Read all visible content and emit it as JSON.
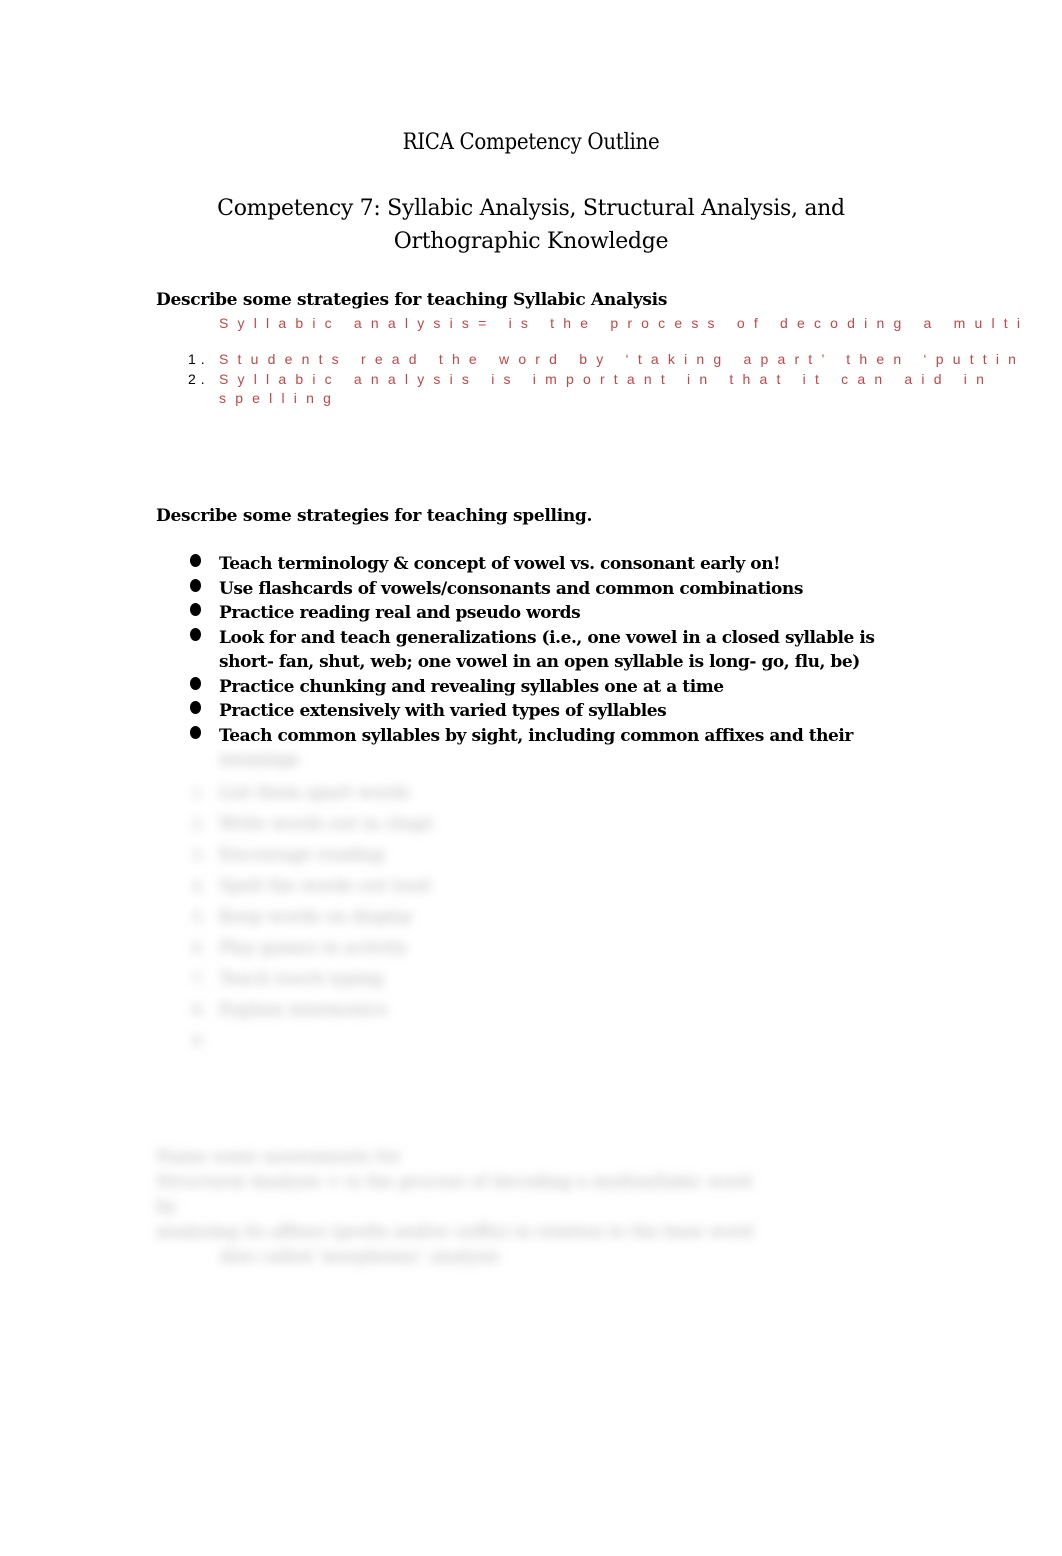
{
  "document": {
    "title": "RICA Competency Outline",
    "subtitle_line1": "Competency 7: Syllabic Analysis, Structural Analysis, and",
    "subtitle_line2": "Orthographic Knowledge"
  },
  "section_syllabic": {
    "heading": "Describe some strategies for teaching Syllabic Analysis",
    "definition": "Syllabic analysis= is the process of decoding a multi",
    "items": [
      {
        "number": "1.",
        "text": "Students read the word by ‘taking apart’ then ‘puttin"
      },
      {
        "number": "2.",
        "text": "Syllabic analysis is important in that it can aid in",
        "continuation": "spelling"
      }
    ],
    "text_color": "#c0474a"
  },
  "section_spelling": {
    "heading": "Describe some strategies for teaching spelling.",
    "bullets": [
      {
        "line1": "Teach terminology & concept of vowel vs. consonant early on!"
      },
      {
        "line1": "Use flashcards of vowels/consonants and common combinations"
      },
      {
        "line1": "Practice reading real and pseudo words"
      },
      {
        "line1": "Look for and teach generalizations (i.e., one vowel in a closed syllable is",
        "line2": "short- fan, shut, web; one vowel in an open syllable is long- go, flu, be)"
      },
      {
        "line1": "Practice chunking and revealing syllables one at a time"
      },
      {
        "line1": "Practice extensively with varied types of syllables"
      },
      {
        "line1": "Teach common syllables by sight, including common affixes and their",
        "line2": "meanings"
      }
    ]
  },
  "blurred_content": {
    "list_items": [
      "List them apart words",
      "Write words out in chapt",
      "Encourage reading",
      "Spell the words out loud",
      "Keep words on display",
      "Play games in activity",
      "Teach touch typing",
      "Explain mnemonics",
      ""
    ],
    "block_lines": [
      "Name some assessments for",
      "Structural Analysis = is the process of decoding a multisyllabic word by",
      "analyzing its affixes (prefix and/or suffix) in relation to the base word",
      "Also called 'morphemic' analysis"
    ]
  }
}
